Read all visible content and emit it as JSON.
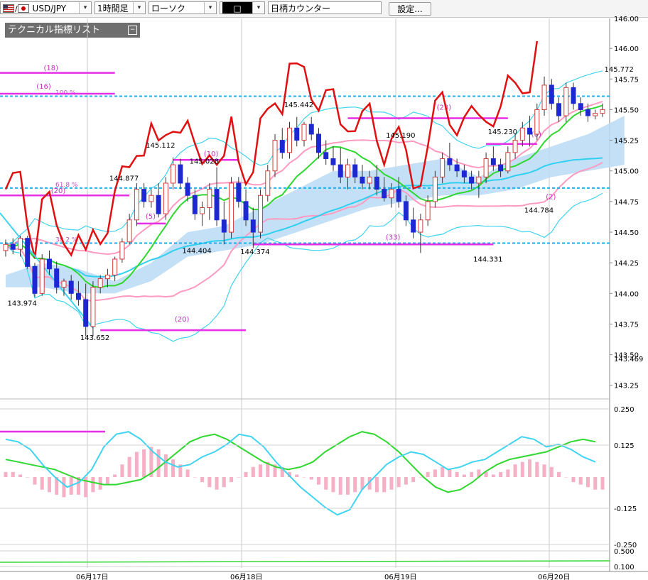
{
  "toolbar": {
    "pair": "USD/JPY",
    "timeframe": "1時間足",
    "chart_type": "ローソク",
    "icon_box": "□",
    "counter": "日柄カウンター",
    "settings": "設定..."
  },
  "indicator_list": {
    "title": "テクニカル指標リスト"
  },
  "colors": {
    "up": "#d23c3c",
    "down": "#1e28d2",
    "red_line": "#e01010",
    "green_line": "#2fd82f",
    "cyan_line": "#40d4f0",
    "pink_line": "#ff9ac0",
    "magenta": "#e62ee6",
    "dotted": "#1ab0f0",
    "cloud": "#b8daf5"
  },
  "chart_data": [
    {
      "type": "candlestick",
      "x_ticks": [
        "06月17日",
        "06月18日",
        "06月19日",
        "06月20日"
      ],
      "y_ticks": [
        "146.00",
        "145.75",
        "145.50",
        "145.25",
        "145.00",
        "144.75",
        "144.50",
        "144.25",
        "144.00",
        "143.75",
        "143.50",
        "143.25"
      ],
      "ylim": [
        143.15,
        146.25
      ],
      "partial_top_tick": "146.00",
      "current_price": "143.469",
      "price_labels": [
        {
          "text": "145.772",
          "x": 84,
          "y": 145.81
        },
        {
          "text": "145.442",
          "x": 40,
          "y": 145.52
        },
        {
          "text": "145.230",
          "x": 68,
          "y": 145.3
        },
        {
          "text": "145.190",
          "x": 54,
          "y": 145.27
        },
        {
          "text": "145.112",
          "x": 21,
          "y": 145.19
        },
        {
          "text": "145.028",
          "x": 27,
          "y": 145.06
        },
        {
          "text": "144.877",
          "x": 16,
          "y": 144.92
        },
        {
          "text": "144.784",
          "x": 73,
          "y": 144.66
        },
        {
          "text": "144.404",
          "x": 26,
          "y": 144.33
        },
        {
          "text": "144.374",
          "x": 34,
          "y": 144.32
        },
        {
          "text": "144.331",
          "x": 66,
          "y": 144.26
        },
        {
          "text": "143.974",
          "x": 2,
          "y": 143.9
        },
        {
          "text": "143.652",
          "x": 12,
          "y": 143.62
        }
      ],
      "fib_labels": [
        {
          "text": "100.%",
          "y": 145.61
        },
        {
          "text": "61.8 %",
          "y": 144.86
        },
        {
          "text": "38.2 %",
          "y": 144.41
        }
      ],
      "count_labels": [
        {
          "text": "(18)",
          "x": 6,
          "y": 145.82
        },
        {
          "text": "(16)",
          "x": 5,
          "y": 145.67
        },
        {
          "text": "(20)",
          "x": 7,
          "y": 144.82
        },
        {
          "text": "(5)",
          "x": 20,
          "y": 144.61
        },
        {
          "text": "(10)",
          "x": 28,
          "y": 145.12
        },
        {
          "text": "(23)",
          "x": 60,
          "y": 145.5
        },
        {
          "text": "(8)",
          "x": 73,
          "y": 145.28
        },
        {
          "text": "(2)",
          "x": 75,
          "y": 144.77
        },
        {
          "text": "(33)",
          "x": 53,
          "y": 144.44
        },
        {
          "text": "(20)",
          "x": 24,
          "y": 143.77
        }
      ],
      "magenta_lines": [
        {
          "x0": -1,
          "x1": 15,
          "y": 145.8
        },
        {
          "x0": -1,
          "x1": 15,
          "y": 145.63
        },
        {
          "x0": -1,
          "x1": 17,
          "y": 144.8
        },
        {
          "x0": 18,
          "x1": 22,
          "y": 144.57
        },
        {
          "x0": 23,
          "x1": 32,
          "y": 145.09
        },
        {
          "x0": 47,
          "x1": 69,
          "y": 145.43
        },
        {
          "x0": 66,
          "x1": 73,
          "y": 145.22
        },
        {
          "x0": 34,
          "x1": 67,
          "y": 144.4
        },
        {
          "x0": 13,
          "x1": 33,
          "y": 143.7
        }
      ],
      "candles": [
        [
          144.35,
          144.44,
          144.3,
          144.4
        ],
        [
          144.4,
          144.45,
          144.32,
          144.36
        ],
        [
          144.36,
          144.47,
          144.3,
          144.45
        ],
        [
          144.45,
          144.47,
          144.2,
          144.22
        ],
        [
          144.22,
          144.25,
          143.97,
          144.0
        ],
        [
          144.0,
          144.32,
          143.98,
          144.28
        ],
        [
          144.28,
          144.35,
          144.15,
          144.2
        ],
        [
          144.2,
          144.26,
          144.0,
          144.05
        ],
        [
          144.05,
          144.12,
          143.98,
          144.1
        ],
        [
          144.1,
          144.15,
          143.95,
          144.0
        ],
        [
          144.0,
          144.1,
          143.9,
          143.95
        ],
        [
          143.95,
          144.08,
          143.65,
          143.73
        ],
        [
          143.73,
          144.1,
          143.65,
          144.05
        ],
        [
          144.05,
          144.15,
          144.0,
          144.12
        ],
        [
          144.12,
          144.2,
          144.05,
          144.15
        ],
        [
          144.15,
          144.3,
          144.1,
          144.28
        ],
        [
          144.28,
          144.45,
          144.25,
          144.42
        ],
        [
          144.42,
          144.65,
          144.4,
          144.6
        ],
        [
          144.6,
          144.9,
          144.55,
          144.85
        ],
        [
          144.85,
          144.9,
          144.7,
          144.75
        ],
        [
          144.75,
          144.85,
          144.7,
          144.8
        ],
        [
          144.8,
          144.9,
          144.62,
          144.65
        ],
        [
          144.65,
          144.95,
          144.6,
          144.9
        ],
        [
          144.9,
          145.11,
          144.85,
          145.05
        ],
        [
          145.05,
          145.1,
          144.85,
          144.9
        ],
        [
          144.9,
          144.95,
          144.75,
          144.8
        ],
        [
          144.8,
          144.85,
          144.6,
          144.65
        ],
        [
          144.65,
          144.75,
          144.55,
          144.7
        ],
        [
          144.7,
          144.9,
          144.6,
          144.85
        ],
        [
          144.85,
          145.03,
          144.55,
          144.6
        ],
        [
          144.6,
          144.75,
          144.4,
          144.5
        ],
        [
          144.5,
          144.95,
          144.45,
          144.9
        ],
        [
          144.9,
          144.95,
          144.7,
          144.75
        ],
        [
          144.75,
          144.85,
          144.55,
          144.6
        ],
        [
          144.6,
          144.7,
          144.37,
          144.5
        ],
        [
          144.5,
          144.85,
          144.45,
          144.8
        ],
        [
          144.8,
          145.05,
          144.75,
          145.0
        ],
        [
          145.0,
          145.3,
          144.95,
          145.25
        ],
        [
          145.25,
          145.35,
          145.1,
          145.15
        ],
        [
          145.15,
          145.4,
          145.1,
          145.35
        ],
        [
          145.35,
          145.44,
          145.2,
          145.25
        ],
        [
          145.25,
          145.4,
          145.2,
          145.38
        ],
        [
          145.38,
          145.44,
          145.25,
          145.3
        ],
        [
          145.3,
          145.35,
          145.1,
          145.15
        ],
        [
          145.15,
          145.25,
          145.05,
          145.1
        ],
        [
          145.1,
          145.2,
          145.0,
          145.05
        ],
        [
          145.05,
          145.19,
          144.9,
          144.95
        ],
        [
          144.95,
          145.1,
          144.85,
          145.05
        ],
        [
          145.05,
          145.1,
          144.9,
          144.95
        ],
        [
          144.95,
          145.05,
          144.85,
          144.9
        ],
        [
          144.9,
          145.0,
          144.85,
          144.95
        ],
        [
          144.95,
          145.05,
          144.8,
          144.85
        ],
        [
          144.85,
          144.95,
          144.75,
          144.78
        ],
        [
          144.78,
          144.9,
          144.7,
          144.85
        ],
        [
          144.85,
          144.95,
          144.7,
          144.75
        ],
        [
          144.75,
          144.8,
          144.55,
          144.6
        ],
        [
          144.6,
          144.7,
          144.45,
          144.5
        ],
        [
          144.5,
          144.65,
          144.33,
          144.6
        ],
        [
          144.6,
          144.8,
          144.55,
          144.75
        ],
        [
          144.75,
          145.0,
          144.7,
          144.95
        ],
        [
          144.95,
          145.15,
          144.9,
          145.1
        ],
        [
          145.1,
          145.23,
          145.0,
          145.05
        ],
        [
          145.05,
          145.1,
          144.95,
          145.0
        ],
        [
          145.0,
          145.05,
          144.9,
          144.95
        ],
        [
          144.95,
          145.0,
          144.85,
          144.9
        ],
        [
          144.9,
          145.0,
          144.78,
          144.95
        ],
        [
          144.95,
          145.15,
          144.9,
          145.1
        ],
        [
          145.1,
          145.2,
          145.0,
          145.05
        ],
        [
          145.05,
          145.1,
          144.95,
          145.0
        ],
        [
          145.0,
          145.2,
          144.98,
          145.15
        ],
        [
          145.15,
          145.3,
          145.1,
          145.25
        ],
        [
          145.25,
          145.4,
          145.2,
          145.35
        ],
        [
          145.35,
          145.45,
          145.2,
          145.3
        ],
        [
          145.3,
          145.55,
          145.25,
          145.5
        ],
        [
          145.5,
          145.77,
          145.45,
          145.7
        ],
        [
          145.7,
          145.75,
          145.5,
          145.55
        ],
        [
          145.55,
          145.6,
          145.4,
          145.45
        ],
        [
          145.45,
          145.72,
          145.4,
          145.68
        ],
        [
          145.68,
          145.72,
          145.5,
          145.55
        ],
        [
          145.55,
          145.6,
          145.45,
          145.5
        ],
        [
          145.5,
          145.55,
          145.4,
          145.45
        ],
        [
          145.45,
          145.5,
          145.42,
          145.47
        ],
        [
          145.47,
          145.55,
          145.44,
          145.5
        ]
      ],
      "ichimoku_cloud": {
        "x0": 0,
        "span_a": [
          144.15,
          144.25,
          144.2,
          144.1,
          144.25,
          144.5,
          144.55,
          144.7,
          144.85,
          145.0,
          145.0,
          145.05,
          145.1,
          144.95,
          145.1,
          145.2,
          145.3,
          145.45
        ],
        "span_b": [
          144.05,
          144.05,
          144.0,
          144.0,
          144.1,
          144.3,
          144.35,
          144.4,
          144.5,
          144.6,
          144.7,
          144.75,
          144.8,
          144.8,
          144.85,
          144.95,
          145.0,
          145.05
        ],
        "step": 5
      },
      "macd": {
        "y_ticks": [
          "0.250",
          "0.125",
          "-0.125",
          "-0.250",
          "0.500",
          "0.100"
        ],
        "ylim": [
          -0.25,
          0.25
        ],
        "histogram": [
          0.02,
          0.02,
          0.01,
          0.0,
          -0.03,
          -0.05,
          -0.06,
          -0.07,
          -0.08,
          -0.07,
          -0.07,
          -0.08,
          -0.06,
          -0.05,
          -0.03,
          0.01,
          0.05,
          0.08,
          0.1,
          0.11,
          0.12,
          0.11,
          0.09,
          0.07,
          0.05,
          0.03,
          0.0,
          -0.02,
          -0.04,
          -0.05,
          -0.04,
          -0.02,
          0.0,
          0.02,
          0.04,
          0.05,
          0.06,
          0.05,
          0.04,
          0.02,
          0.01,
          0.0,
          -0.01,
          -0.03,
          -0.05,
          -0.06,
          -0.07,
          -0.07,
          -0.06,
          -0.05,
          -0.05,
          -0.06,
          -0.06,
          -0.05,
          -0.04,
          -0.03,
          -0.02,
          0.0,
          0.02,
          0.03,
          0.04,
          0.03,
          0.02,
          0.01,
          0.02,
          0.03,
          0.02,
          0.01,
          0.02,
          0.03,
          0.05,
          0.06,
          0.07,
          0.06,
          0.05,
          0.04,
          0.02,
          0.0,
          -0.02,
          -0.03,
          -0.04,
          -0.05,
          -0.05
        ],
        "signal": [
          0.07,
          0.06,
          0.05,
          0.04,
          0.03,
          0.01,
          -0.01,
          -0.02,
          -0.03,
          -0.03,
          -0.02,
          -0.01,
          0.02,
          0.06,
          0.1,
          0.14,
          0.16,
          0.17,
          0.15,
          0.12,
          0.09,
          0.06,
          0.04,
          0.03,
          0.04,
          0.06,
          0.1,
          0.13,
          0.16,
          0.18,
          0.17,
          0.14,
          0.1,
          0.05,
          0.0,
          -0.04,
          -0.06,
          -0.05,
          -0.02,
          0.02,
          0.05,
          0.07,
          0.08,
          0.09,
          0.1,
          0.12,
          0.14,
          0.15,
          0.14
        ],
        "macd_line": [
          0.15,
          0.14,
          0.11,
          0.05,
          0.0,
          -0.04,
          -0.02,
          0.03,
          0.12,
          0.17,
          0.18,
          0.15,
          0.1,
          0.06,
          0.04,
          0.05,
          0.08,
          0.1,
          0.13,
          0.17,
          0.16,
          0.12,
          0.06,
          0.01,
          -0.04,
          -0.08,
          -0.12,
          -0.15,
          -0.13,
          -0.05,
          0.0,
          0.05,
          0.08,
          0.1,
          0.09,
          0.06,
          0.03,
          0.04,
          0.06,
          0.07,
          0.1,
          0.13,
          0.16,
          0.15,
          0.12,
          0.13,
          0.11,
          0.08,
          0.06
        ]
      }
    }
  ]
}
